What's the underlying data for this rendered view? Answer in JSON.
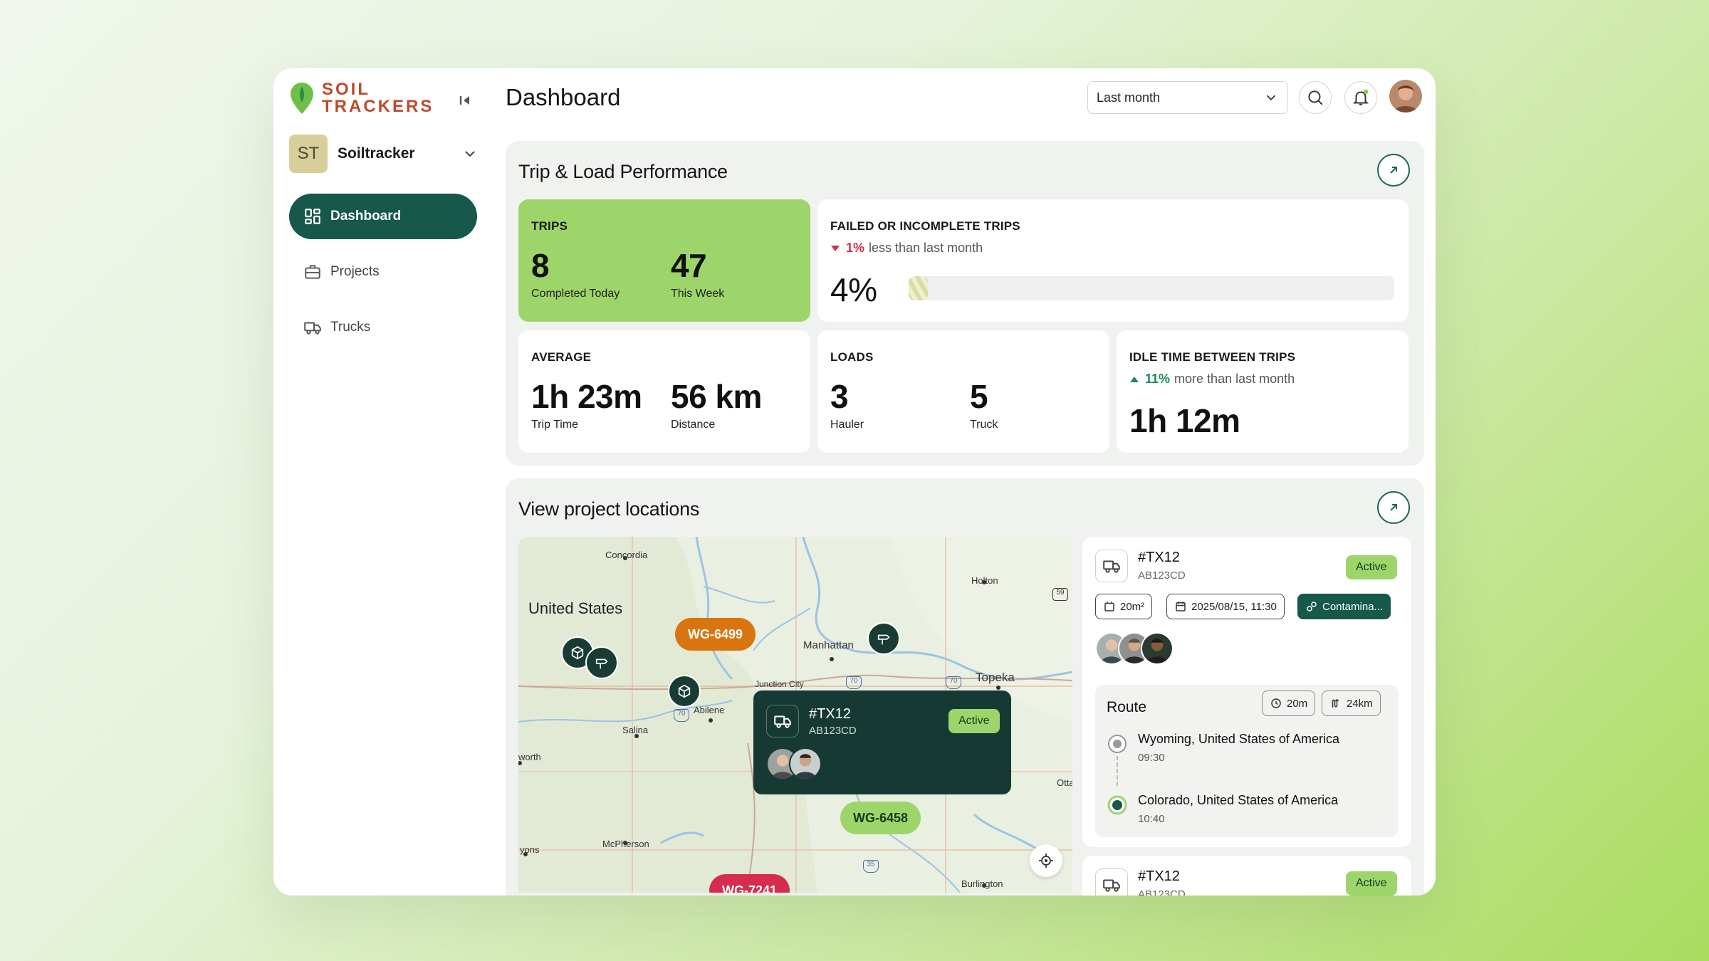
{
  "brand": {
    "line1": "SOIL",
    "line2": "TRACKERS"
  },
  "workspace": {
    "initials": "ST",
    "name": "Soiltracker"
  },
  "nav": {
    "dashboard": "Dashboard",
    "projects": "Projects",
    "trucks": "Trucks"
  },
  "header": {
    "title": "Dashboard",
    "period": "Last month"
  },
  "performance": {
    "title": "Trip & Load Performance",
    "trips": {
      "label": "TRIPS",
      "today_value": "8",
      "today_label": "Completed Today",
      "week_value": "47",
      "week_label": "This Week"
    },
    "failed": {
      "label": "FAILED OR INCOMPLETE TRIPS",
      "delta_pct": "1%",
      "delta_text": "less than last month",
      "value": "4%",
      "fraction": 0.04
    },
    "average": {
      "label": "AVERAGE",
      "trip_time": "1h 23m",
      "trip_time_label": "Trip Time",
      "distance": "56 km",
      "distance_label": "Distance"
    },
    "loads": {
      "label": "LOADS",
      "hauler": "3",
      "hauler_label": "Hauler",
      "truck": "5",
      "truck_label": "Truck"
    },
    "idle": {
      "label": "IDLE TIME BETWEEN TRIPS",
      "delta_pct": "11%",
      "delta_text": "more than last month",
      "value": "1h 12m"
    }
  },
  "locations": {
    "title": "View project locations",
    "map": {
      "country": "United States",
      "places": {
        "concordia": "Concordia",
        "holton": "Holton",
        "manhattan": "Manhattan",
        "junction": "Junction City",
        "topeka": "Topeka",
        "abilene": "Abilene",
        "salina": "Salina",
        "worth": "worth",
        "mcpherson": "McPherson",
        "yons": "yons",
        "burlington": "Burlington",
        "otta": "Otta"
      },
      "highways": {
        "h70a": "70",
        "h70b": "70",
        "h70c": "70",
        "h35": "35",
        "h59": "59"
      },
      "pins": {
        "a": "WG-6499",
        "b": "WG-6458",
        "c": "WG-7241"
      },
      "popup": {
        "id": "#TX12",
        "plate": "AB123CD",
        "status": "Active"
      }
    },
    "vehicles": [
      {
        "id": "#TX12",
        "plate": "AB123CD",
        "status": "Active",
        "area": "20m²",
        "datetime": "2025/08/15, 11:30",
        "tag": "Contamina...",
        "route": {
          "title": "Route",
          "duration": "20m",
          "distance": "24km",
          "from": "Wyoming, United States of America",
          "from_time": "09:30",
          "to": "Colorado, United States of America",
          "to_time": "10:40"
        }
      },
      {
        "id": "#TX12",
        "plate": "AB123CD",
        "status": "Active"
      }
    ]
  },
  "colors": {
    "brand": "#c0492c",
    "primary": "#16584a",
    "accent": "#9ed56a",
    "down": "#d62c4e",
    "up": "#1b8a5a",
    "pin_orange": "#d9740e"
  }
}
